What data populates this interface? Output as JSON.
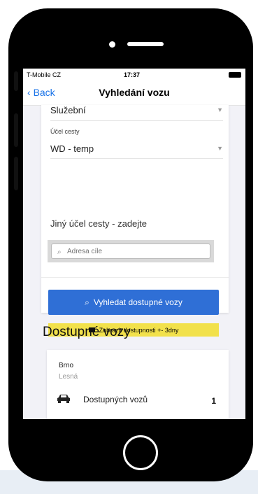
{
  "status_bar": {
    "carrier": "T-Mobile CZ",
    "time": "17:37"
  },
  "nav": {
    "back_label": "Back",
    "title": "Vyhledání vozu"
  },
  "form": {
    "type_value": "Služební",
    "purpose_label": "Účel cesty",
    "purpose_value": "WD - temp",
    "other_purpose_label": "Jiný účel cesty - zadejte",
    "address_placeholder": "Adresa cíle",
    "search_button_label": "Vyhledat dostupné vozy",
    "availability_button_label": "Zobrazit dostupnosti +- 3dny"
  },
  "results": {
    "title": "Dostupné vozy",
    "items": [
      {
        "city": "Brno",
        "branch": "Lesná",
        "available_label": "Dostupných vozů",
        "count": "1"
      }
    ]
  },
  "colors": {
    "primary": "#2f6fd6",
    "accent_yellow": "#f2e14b",
    "link": "#1a73e8"
  },
  "icons": [
    "chevron-left-icon",
    "search-icon",
    "calendar-icon",
    "car-icon",
    "wifi-icon",
    "battery-icon"
  ]
}
